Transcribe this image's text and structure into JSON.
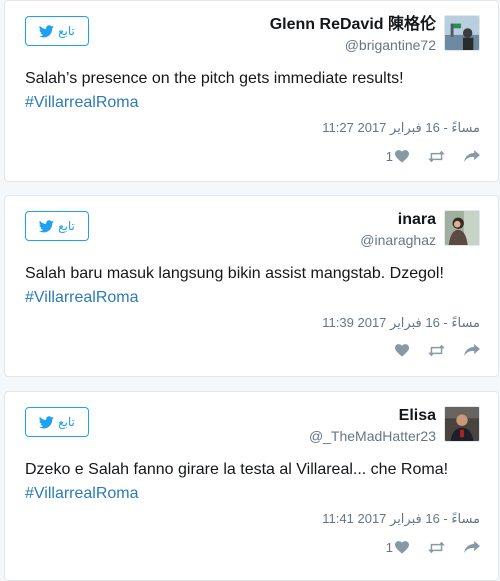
{
  "colors": {
    "accent": "#1da1f2",
    "hashtag": "#2b7bb9",
    "muted": "#657786",
    "icon": "#8899a6"
  },
  "follow_label": "تابع",
  "tweets": [
    {
      "display_name": "Glenn ReDavid 陳格伦",
      "handle": "@brigantine72",
      "text": "Salah’s presence on the pitch gets immediate results!",
      "hashtag": "#VillarrealRoma",
      "timestamp": "11:27 مساءً - 16 فبراير 2017",
      "likes": "1"
    },
    {
      "display_name": "inara",
      "handle": "@inaraghaz",
      "text": "Salah baru masuk langsung bikin assist mangstab. Dzegol!",
      "hashtag": "#VillarrealRoma",
      "timestamp": "11:39 مساءً - 16 فبراير 2017",
      "likes": ""
    },
    {
      "display_name": "Elisa",
      "handle": "@_TheMadHatter23",
      "text": "Dzeko e Salah fanno girare la testa al Villareal... che Roma!",
      "hashtag": "#VillarrealRoma",
      "timestamp": "11:41 مساءً - 16 فبراير 2017",
      "likes": "1"
    }
  ],
  "icons": {
    "follow": "twitter-bird-icon",
    "like": "heart-icon",
    "retweet": "retweet-icon",
    "reply": "reply-icon"
  }
}
